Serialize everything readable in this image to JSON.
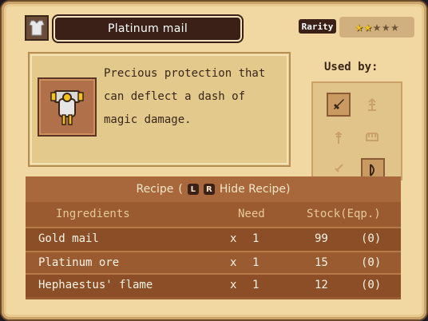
{
  "header": {
    "item_name": "Platinum mail",
    "rarity_label": "Rarity",
    "rarity_stars": [
      "★",
      "★",
      "★",
      "★",
      "★"
    ],
    "rarity_value": 2,
    "rarity_max": 5
  },
  "description": {
    "lines": [
      "Precious protection that",
      "can deflect a dash of",
      "magic damage."
    ]
  },
  "used_by": {
    "label": "Used by:",
    "slots": [
      "sword-icon",
      "staff-icon",
      "scepter-icon",
      "gauntlet-icon",
      "dagger-icon",
      "bow-icon"
    ]
  },
  "recipe": {
    "label": "Recipe",
    "open_paren": "(",
    "button_l": "L",
    "button_r": "R",
    "hide_label": "Hide Recipe)"
  },
  "table": {
    "headers": {
      "ingredients": "Ingredients",
      "need": "Need",
      "stock": "Stock(Eqp.)"
    },
    "rows": [
      {
        "name": "Gold mail",
        "times": "x",
        "need": "1",
        "stock": "99",
        "eqp": "(0)"
      },
      {
        "name": "Platinum ore",
        "times": "x",
        "need": "1",
        "stock": "15",
        "eqp": "(0)"
      },
      {
        "name": "Hephaestus' flame",
        "times": "x",
        "need": "1",
        "stock": "12",
        "eqp": "(0)"
      }
    ]
  },
  "colors": {
    "parchment": "#f1d7a1",
    "title_bg": "#3a2016",
    "table_bg": "#9a5b30",
    "star_on": "#f0c21a"
  }
}
